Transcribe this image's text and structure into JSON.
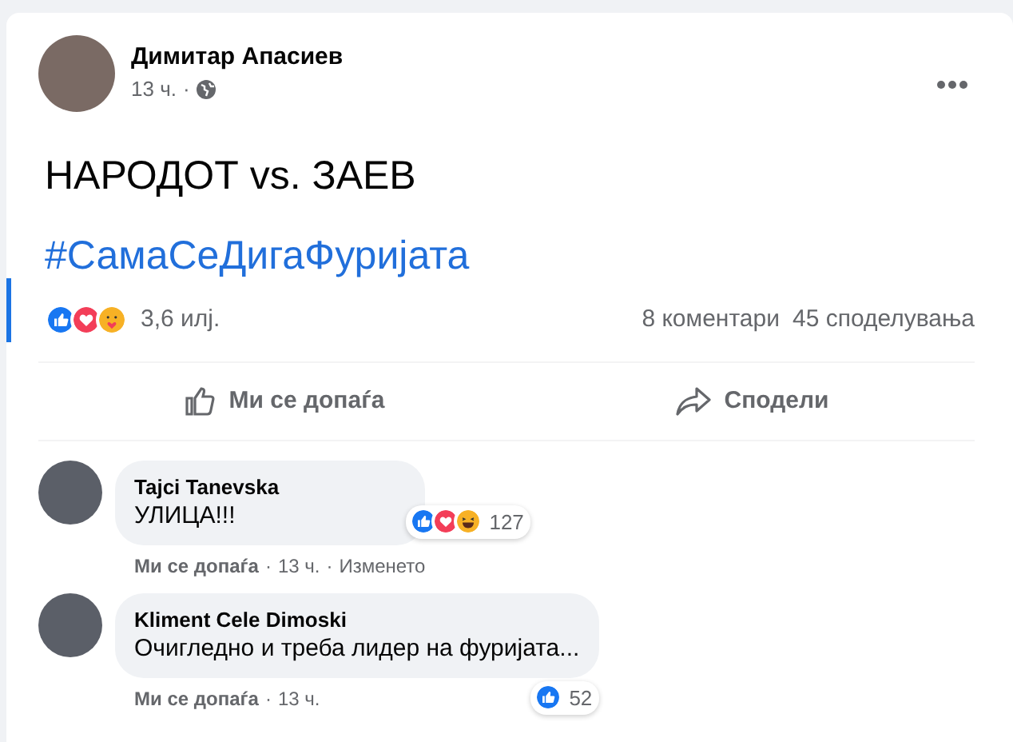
{
  "post": {
    "author": "Димитар Апасиев",
    "time": "13 ч.",
    "separator": "·",
    "text": "НАРОДОТ vs. ЗАЕВ",
    "hashtag": "#СамаСеДигаФуријата",
    "reactions": [
      {
        "kind": "like"
      },
      {
        "kind": "love"
      },
      {
        "kind": "care"
      }
    ],
    "reaction_count": "3,6 илј.",
    "comments_count": "8 коментари",
    "shares_count": "45 споделувања"
  },
  "actions": [
    {
      "kind": "like",
      "label": "Ми се допаѓа"
    },
    {
      "kind": "share",
      "label": "Сподели"
    }
  ],
  "comments": [
    {
      "author": "Tajci Tanevska",
      "text": "УЛИЦА!!!",
      "reactions": [
        {
          "kind": "like"
        },
        {
          "kind": "love"
        },
        {
          "kind": "haha"
        }
      ],
      "reaction_count": "127",
      "meta": [
        {
          "kind": "link",
          "text": "Ми се допаѓа"
        },
        {
          "kind": "dot",
          "text": "·"
        },
        {
          "kind": "plain",
          "text": "13 ч."
        },
        {
          "kind": "dot",
          "text": "·"
        },
        {
          "kind": "plain",
          "text": "Изменето"
        }
      ]
    },
    {
      "author": "Kliment Cele Dimoski",
      "text": "Очигледно и треба лидер на фуријата...",
      "reactions": [
        {
          "kind": "like"
        }
      ],
      "reaction_count": "52",
      "meta": [
        {
          "kind": "link",
          "text": "Ми се допаѓа"
        },
        {
          "kind": "dot",
          "text": "·"
        },
        {
          "kind": "plain",
          "text": "13 ч."
        }
      ]
    }
  ]
}
